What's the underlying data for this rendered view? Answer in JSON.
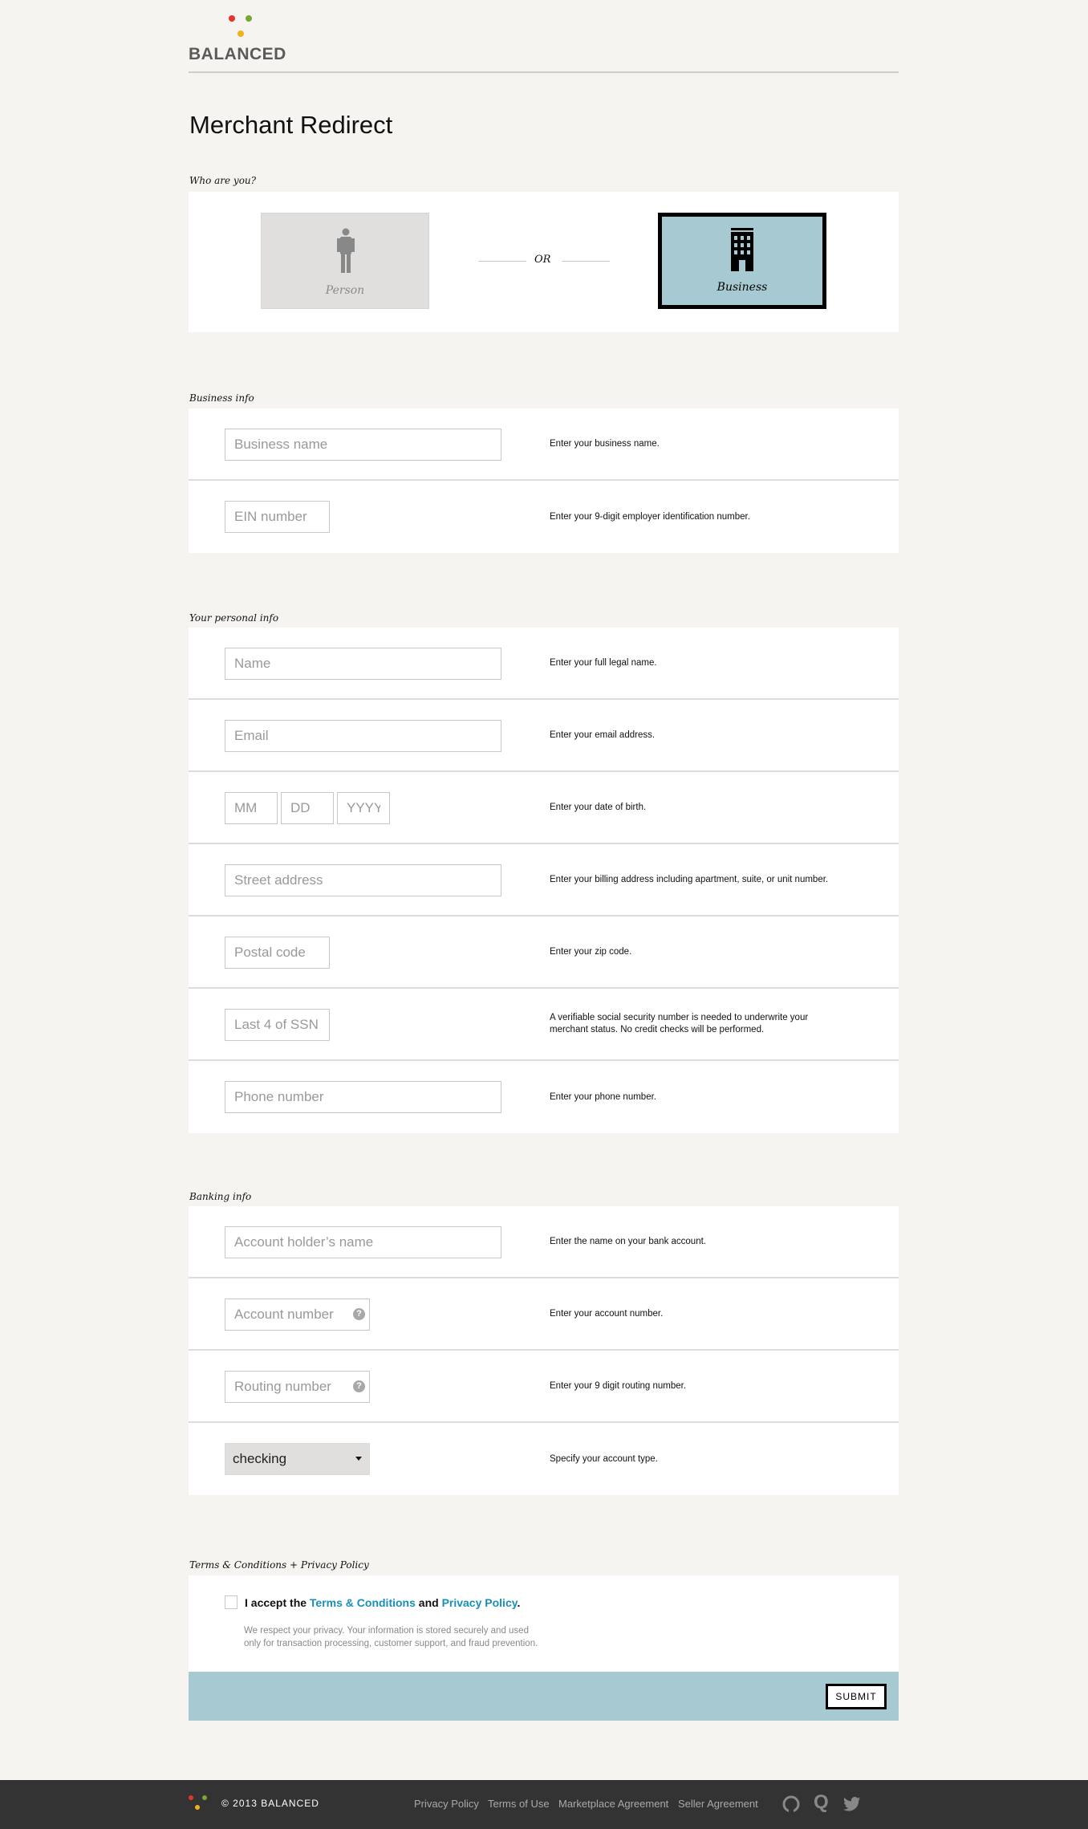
{
  "brand": {
    "name": "BALANCED",
    "dot_colors": [
      "#e8322b",
      "#76a832",
      "#f0b21c"
    ]
  },
  "page_title": "Merchant Redirect",
  "who": {
    "label": "Who are you?",
    "or": "OR",
    "options": [
      {
        "label": "Person",
        "icon": "person-icon",
        "selected": false
      },
      {
        "label": "Business",
        "icon": "building-icon",
        "selected": true
      }
    ]
  },
  "business": {
    "label": "Business info",
    "fields": [
      {
        "placeholder": "Business name",
        "help": "Enter your business name."
      },
      {
        "placeholder": "EIN number",
        "help": "Enter your 9-digit employer identification number."
      }
    ]
  },
  "personal": {
    "label": "Your personal info",
    "fields": [
      {
        "placeholder": "Name",
        "help": "Enter your full legal name."
      },
      {
        "placeholder": "Email",
        "help": "Enter your email address."
      },
      {
        "placeholders": [
          "MM",
          "DD",
          "YYYY"
        ],
        "help": "Enter your date of birth."
      },
      {
        "placeholder": "Street address",
        "help": "Enter your billing address including apartment, suite, or unit number."
      },
      {
        "placeholder": "Postal code",
        "help": "Enter your zip code."
      },
      {
        "placeholder": "Last 4 of SSN",
        "help": "A verifiable social security number is needed to underwrite your merchant status. No credit checks will be performed."
      },
      {
        "placeholder": "Phone number",
        "help": "Enter your phone number."
      }
    ]
  },
  "banking": {
    "label": "Banking info",
    "fields": [
      {
        "placeholder": "Account holder’s name",
        "help": "Enter the name on your bank account."
      },
      {
        "placeholder": "Account number",
        "help": "Enter your account number.",
        "icon": "question-icon"
      },
      {
        "placeholder": "Routing number",
        "help": "Enter your 9 digit routing number.",
        "icon": "question-icon"
      },
      {
        "select_value": "checking",
        "help": "Specify your account type."
      }
    ]
  },
  "terms": {
    "label": "Terms & Conditions + Privacy Policy",
    "accept_prefix": "I accept the",
    "terms_link": "Terms & Conditions",
    "and": "and",
    "privacy_link": "Privacy Policy",
    "period": ".",
    "privacy_line1": "We respect your privacy. Your information is stored securely and used",
    "privacy_line2": "only for transaction processing, customer support, and fraud prevention.",
    "checked": false,
    "submit": "SUBMIT",
    "accent": "#a7cad2",
    "link_color": "#1a8fb5"
  },
  "footer": {
    "copyright": "© 2013 BALANCED",
    "links": [
      "Privacy Policy",
      "Terms of Use",
      "Marketplace Agreement",
      "Seller Agreement"
    ],
    "icons": [
      "github-icon",
      "quora-icon",
      "twitter-icon"
    ]
  }
}
